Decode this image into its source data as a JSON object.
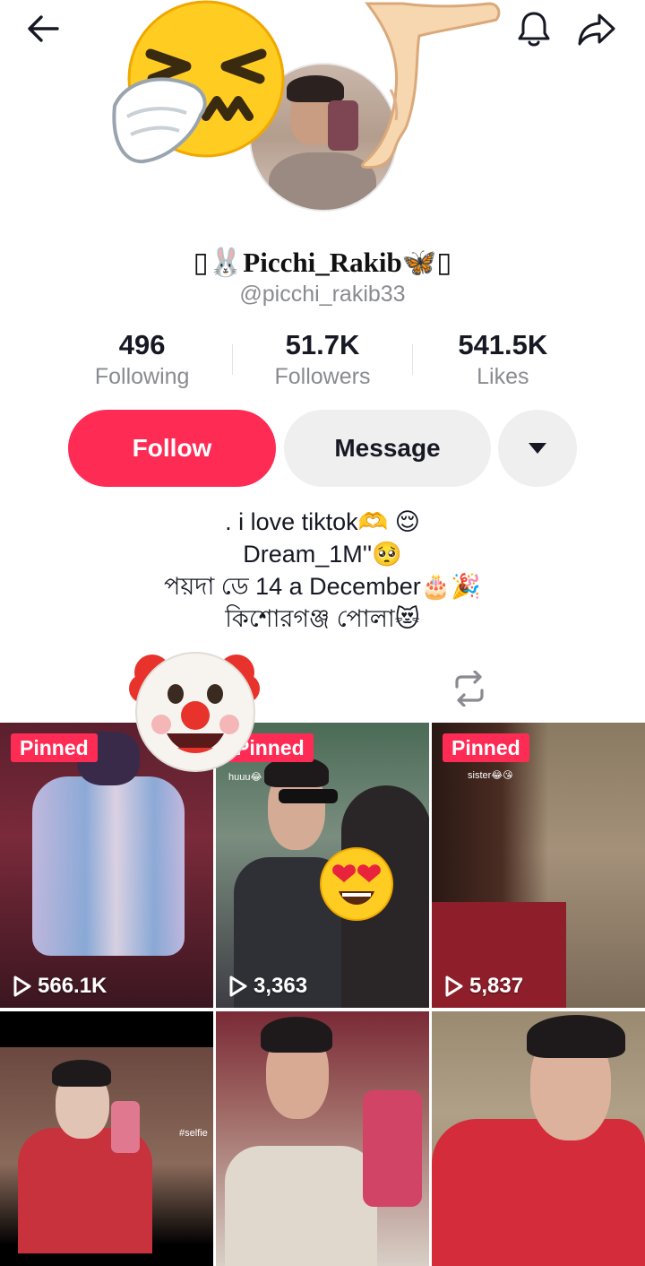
{
  "profile": {
    "display_name": "▯🐰Picchi_Rakib🦋▯",
    "handle": "@picchi_rakib33"
  },
  "stats": {
    "following": {
      "value": "496",
      "label": "Following"
    },
    "followers": {
      "value": "51.7K",
      "label": "Followers"
    },
    "likes": {
      "value": "541.5K",
      "label": "Likes"
    }
  },
  "actions": {
    "follow_label": "Follow",
    "message_label": "Message"
  },
  "bio": {
    "lines": [
      ". i love tiktok🫶 😌",
      "Dream_1M''🥺",
      "পয়দা ডে 14 a December🎂🎉",
      "কিশোরগঞ্জ পোলা😻"
    ]
  },
  "videos": [
    {
      "pinned": "Pinned",
      "views": "566.1K"
    },
    {
      "pinned": "Pinned",
      "views": "3,363",
      "caption": "huuu😂"
    },
    {
      "pinned": "Pinned",
      "views": "5,837",
      "caption": "sister😂😘"
    },
    {
      "caption": "#selfie"
    },
    {},
    {}
  ],
  "colors": {
    "accent": "#fe2c55",
    "secondary_button": "#efefef",
    "muted_text": "#8a8b91"
  },
  "icons": [
    "back-arrow-icon",
    "bell-icon",
    "share-icon",
    "dropdown-caret-icon",
    "repost-icon",
    "play-icon"
  ]
}
